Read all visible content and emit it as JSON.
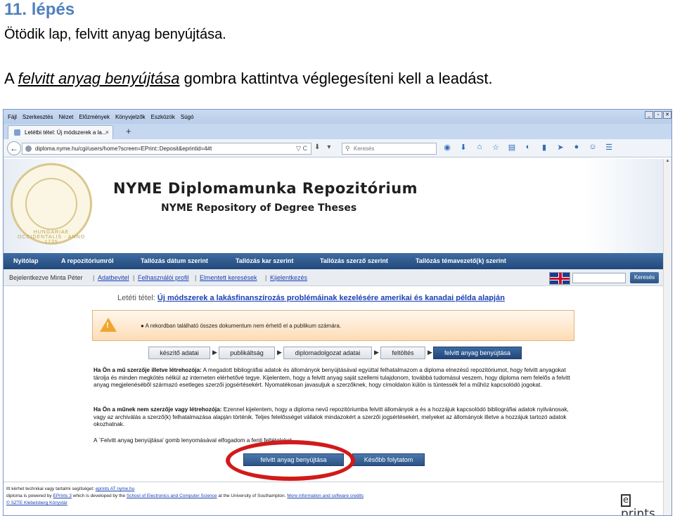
{
  "doc": {
    "step_title": "11. lépés",
    "step_subtitle": "Ötödik lap, felvitt anyag benyújtása.",
    "desc_prefix": "A ",
    "desc_link": "felvitt anyag benyújtása",
    "desc_suffix": " gombra kattintva véglegesíteni kell a leadást."
  },
  "browser": {
    "menu": [
      "Fájl",
      "Szerkesztés",
      "Nézet",
      "Előzmények",
      "Könyvjelzők",
      "Eszközök",
      "Súgó"
    ],
    "win_buttons": [
      "_",
      "▫",
      "✕"
    ],
    "tab_title": "Letétbi tétel: Új módszerek a la...",
    "tab_close": "×",
    "new_tab": "+",
    "url": "diploma.nyme.hu/cgi/users/home?screen=EPrint::Deposit&eprintid=4#t",
    "url_tail": "▽ C",
    "search_placeholder": "Keresés"
  },
  "site": {
    "seal_text": "HUNGARIAE OCCIDENTALIS · ANNO 1735",
    "title": "NYME Diplomamunka Repozitórium",
    "subtitle": "NYME Repository of Degree Theses",
    "nav": [
      "Nyitólap",
      "A repozitóriumról",
      "Tallózás dátum szerint",
      "Tallózás kar szerint",
      "Tallózás szerző szerint",
      "Tallózás témavezető(k) szerint"
    ],
    "user": {
      "logged_in": "Bejelentkezve Minta Péter",
      "links": [
        "Adatbevitel",
        "Felhasználói profil",
        "Elmentett keresések",
        "Kijelentkezés"
      ],
      "search_button": "Keresés"
    },
    "deposit_label": "Letéti tétel:",
    "deposit_title": "Új módszerek a lakásfinanszírozás problémáinak kezelésére amerikai és kanadai példa alapján",
    "warning": "A rekordban található összes dokumentum nem érhető el a publikum számára.",
    "steps": [
      "készítő adatai",
      "publikáltság",
      "diplomadolgozat adatai",
      "feltöltés",
      "felvitt anyag benyújtása"
    ],
    "para1_bold": "Ha Ön a mű szerzője illetve létrehozója:",
    "para1": " A megadott bibliográfiai adatok és állományok benyújtásával egyúttal felhatalmazom a diploma elnezésű repozitóriumot, hogy felvitt anyagokat tárolja és minden megkötés nélkül az interneten elérhetővé tegye. Kijelentem, hogy a felvitt anyag saját szellemi tulajdonom, továbbá tudomásul veszem, hogy diploma nem felelős a felvitt anyag megjelenéséből származó esetleges szerzői jogsértésekért. Nyomatékosan javasuljuk a szerzőknek, hogy címoldalon külön is tüntessék fel a műhöz kapcsolódó jogokat.",
    "para2_bold": "Ha Ön a műnek nem szerzője vagy létrehozója:",
    "para2": " Ezennel kijelentem, hogy a diploma nevű repozitóriumba felvitt állományok a és a hozzájuk kapcsolódó bibliográfiai adatok nyilvánosak, vagy az archiválás a szerző(k) felhatalmazása alapján történik. Teljes felelősséget vállalok mindazokért a szerzői jogsértésekért, melyeket az állományok illetve a hozzájuk tartozó adatok okozhatnak.",
    "para3": "A `Felvitt anyag benyújtása' gomb lenyomásával elfogadom a fenti feltételeket.",
    "btn_submit": "felvitt anyag benyújtása",
    "btn_later": "Később folytatom",
    "footer": {
      "line1_pre": "Itt kérhet technikai vagy tartalmi segítséget: ",
      "line1_link": "eprints AT nyme.hu",
      "line2_pre": "diploma is powered by ",
      "line2_link1": "EPrints 3",
      "line2_mid": " which is developed by the ",
      "line2_link2": "School of Electronics and Computer Science",
      "line2_mid2": " at the University of Southampton. ",
      "line2_link3": "More information and software credits",
      "line3_link": "© SZTE Klebelsberg Könyvtár",
      "logo": "prints"
    }
  }
}
